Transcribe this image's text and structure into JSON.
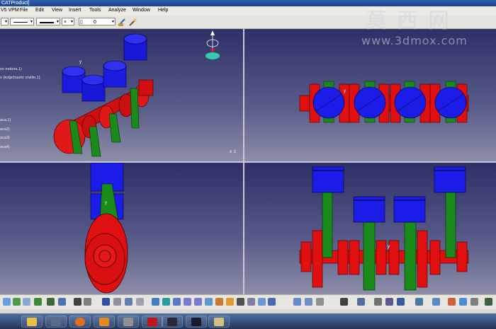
{
  "window": {
    "title": "CATProduct]"
  },
  "menubar": {
    "workbench": "V5 VPM",
    "items": [
      "File",
      "Edit",
      "View",
      "Insert",
      "Tools",
      "Analyze",
      "Window",
      "Help"
    ]
  },
  "property_toolbar": {
    "color_value": "",
    "transparency_value": "0"
  },
  "tree": {
    "root_items": [
      "ox motora.1)",
      "o (kolječnasto vratilo.1)"
    ],
    "sub_items": [
      "aca.1)",
      "aca2)",
      "aca3)",
      "aca4)"
    ]
  },
  "axis_labels": {
    "y": "y",
    "xz": "x",
    "z": "z"
  },
  "watermark": {
    "cn": "莫西网",
    "url": "www.3dmox.com"
  },
  "colors": {
    "piston": "#1818e0",
    "connecting_rod": "#0e7a0e",
    "crankshaft": "#e01010",
    "viewport_top": "#2e2f66",
    "viewport_bottom": "#8c8ea8"
  }
}
